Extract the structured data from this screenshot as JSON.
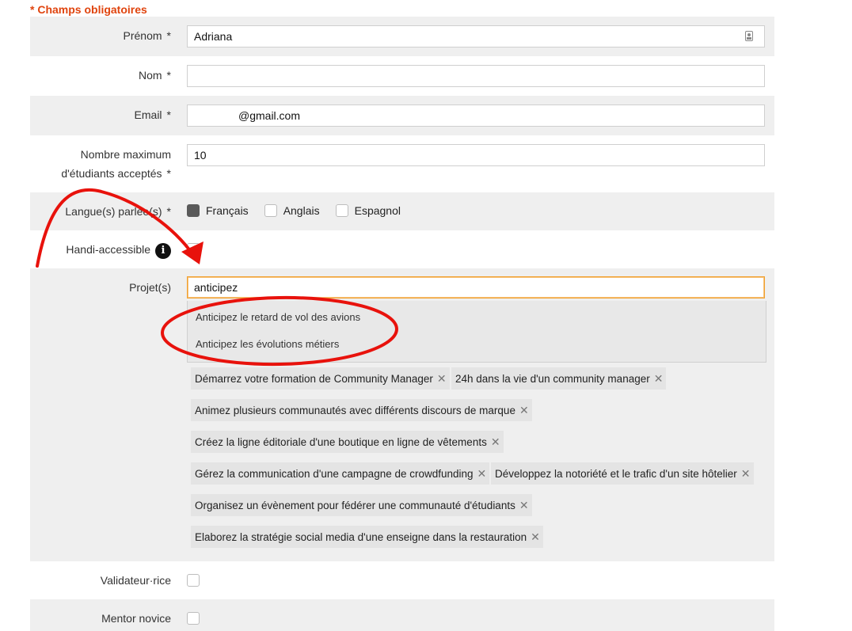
{
  "required_note": "* Champs obligatoires",
  "required_star": "*",
  "fields": {
    "prenom": {
      "label": "Prénom",
      "value": "Adriana"
    },
    "nom": {
      "label": "Nom",
      "value": ""
    },
    "email": {
      "label": "Email",
      "value": "@gmail.com"
    },
    "max_students": {
      "label_line1": "Nombre maximum",
      "label_line2": "d'étudiants acceptés",
      "value": "10"
    },
    "languages": {
      "label": "Langue(s) parlée(s)",
      "options": [
        {
          "label": "Français",
          "checked": true
        },
        {
          "label": "Anglais",
          "checked": false
        },
        {
          "label": "Espagnol",
          "checked": false
        }
      ]
    },
    "handi": {
      "label": "Handi-accessible",
      "info_glyph": "i",
      "checked": false
    },
    "projets": {
      "label": "Projet(s)",
      "search_value": "anticipez",
      "suggestions": [
        "Anticipez le retard de vol des avions",
        "Anticipez les évolutions métiers"
      ],
      "tags": [
        "Démarrez votre formation de Community Manager",
        "24h dans la vie d'un community manager",
        "Animez plusieurs communautés avec différents discours de marque",
        "Créez la ligne éditoriale d'une boutique en ligne de vêtements",
        "Gérez la communication d'une campagne de crowdfunding",
        "Développez la notoriété et le trafic d'un site hôtelier",
        "Organisez un évènement pour fédérer une communauté d'étudiants",
        "Elaborez la stratégie social media d'une enseigne dans la restauration"
      ],
      "remove_glyph": "✕"
    },
    "validateur": {
      "label": "Validateur·rice",
      "checked": false
    },
    "mentor": {
      "label": "Mentor novice",
      "checked": false
    }
  },
  "colors": {
    "accent": "#e0440e",
    "annotation": "#e8120c",
    "row_shade": "#efefef",
    "focus_border": "#f0a030"
  }
}
